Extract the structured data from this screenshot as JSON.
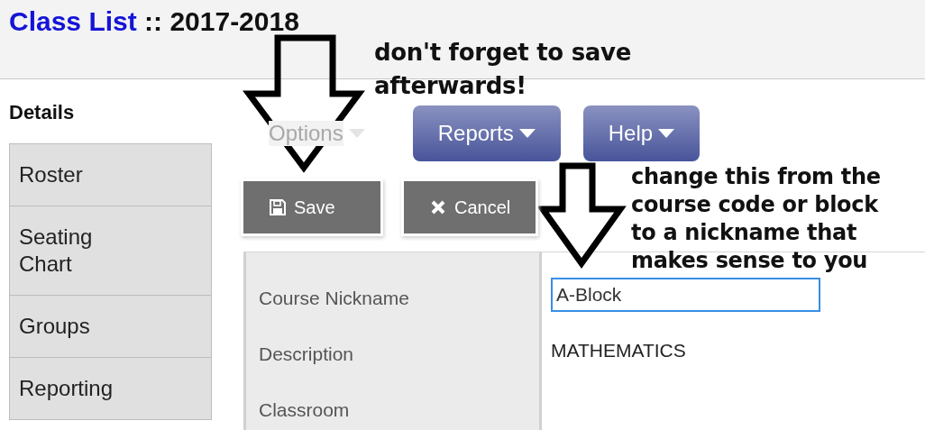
{
  "header": {
    "title": "Class List",
    "subtitle": ":: 2017-2018"
  },
  "sidebar": {
    "items": [
      {
        "label": "Details",
        "selected": true
      },
      {
        "label": "Roster",
        "selected": false
      },
      {
        "label": "Seating Chart",
        "selected": false
      },
      {
        "label": "Groups",
        "selected": false
      },
      {
        "label": "Reporting",
        "selected": false
      }
    ]
  },
  "toolbar": {
    "menus": [
      {
        "label": "Options",
        "disabled": true
      },
      {
        "label": "Reports",
        "disabled": false
      },
      {
        "label": "Help",
        "disabled": false
      }
    ],
    "actions": [
      {
        "label": "Save",
        "kind": "save"
      },
      {
        "label": "Cancel",
        "kind": "cancel"
      }
    ]
  },
  "form": {
    "fields": [
      {
        "label": "Course Nickname",
        "kind": "input",
        "value": "A-Block"
      },
      {
        "label": "Description",
        "kind": "text",
        "value": "MATHEMATICS"
      },
      {
        "label": "Classroom",
        "kind": "text"
      }
    ]
  },
  "annotations": [
    {
      "text": "don't forget to save afterwards!",
      "kind": "save"
    },
    {
      "text": "change this from the course code or block to a nickname that makes sense to you",
      "kind": "field"
    }
  ]
}
